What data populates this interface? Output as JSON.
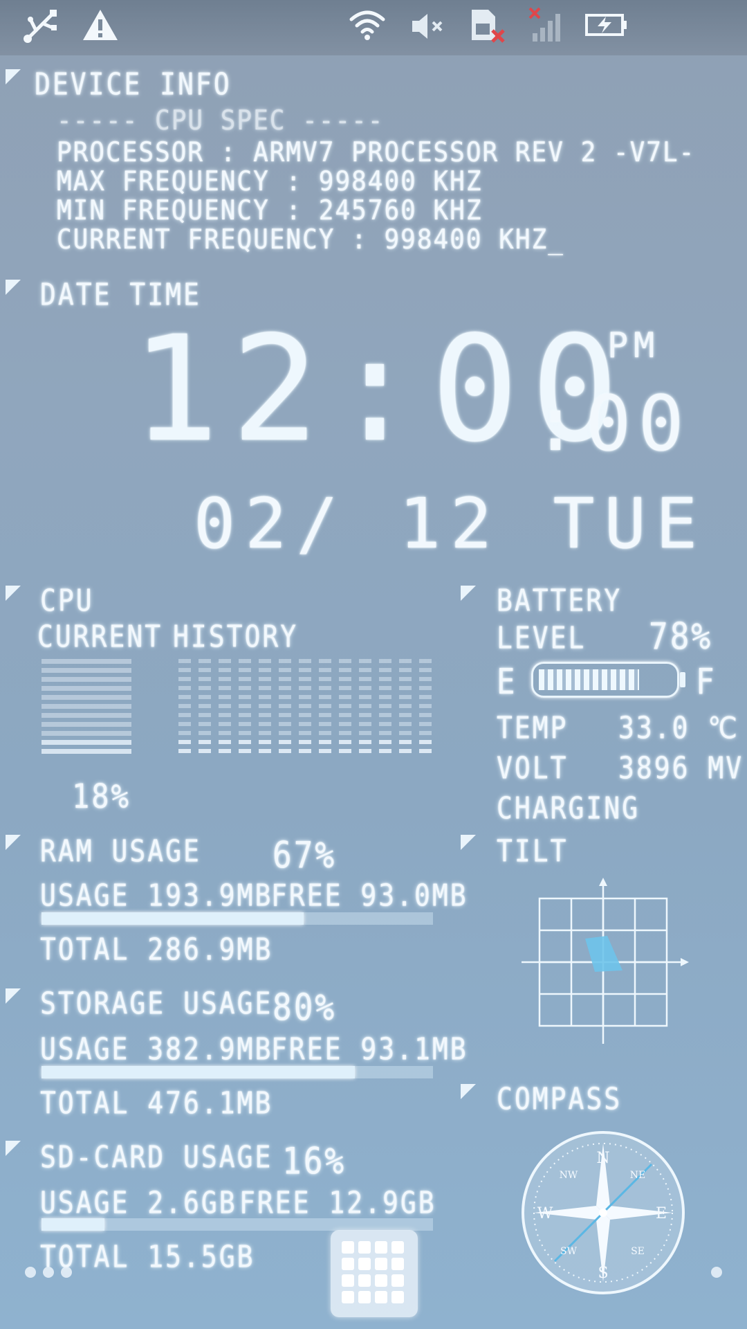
{
  "status_bar": {
    "icons": [
      "usb-icon",
      "warning-icon",
      "wifi-icon",
      "mute-icon",
      "no-sim-icon",
      "no-signal-icon",
      "battery-charging-icon"
    ]
  },
  "device_info": {
    "title": "DEVICE INFO",
    "cpu_spec_header": "-----  CPU SPEC  -----",
    "processor": "PROCESSOR : ARMV7 PROCESSOR REV 2 -V7L-",
    "max_freq": "MAX FREQUENCY : 998400 KHZ",
    "min_freq": "MIN FREQUENCY : 245760 KHZ",
    "cur_freq": "CURRENT FREQUENCY : 998400 KHZ_"
  },
  "date_time": {
    "title": "DATE TIME",
    "time": "12:00",
    "seconds": ":00",
    "ampm": "PM",
    "date": "02/ 12  TUE"
  },
  "cpu": {
    "title": "CPU",
    "current_label": "CURRENT",
    "history_label": "HISTORY",
    "percent": "18%"
  },
  "battery": {
    "title": "BATTERY",
    "level_label": "LEVEL",
    "level": "78%",
    "level_fraction": 0.78,
    "empty": "E",
    "full": "F",
    "temp_label": "TEMP",
    "temp": "33.0 ℃",
    "volt_label": "VOLT",
    "volt": "3896 MV",
    "status": "CHARGING"
  },
  "ram": {
    "title": "RAM USAGE",
    "percent": "67%",
    "usage": "USAGE 193.9MB",
    "free": "FREE 93.0MB",
    "total": "TOTAL 286.9MB",
    "fraction": 0.67
  },
  "storage": {
    "title": "STORAGE USAGE",
    "percent": "80%",
    "usage": "USAGE 382.9MB",
    "free": "FREE 93.1MB",
    "total": "TOTAL 476.1MB",
    "fraction": 0.8
  },
  "sdcard": {
    "title": "SD-CARD USAGE",
    "percent": "16%",
    "usage": "USAGE 2.6GB",
    "free": "FREE 12.9GB",
    "total": "TOTAL 15.5GB",
    "fraction": 0.16
  },
  "tilt": {
    "title": "TILT"
  },
  "compass": {
    "title": "COMPASS",
    "n": "N",
    "s": "S",
    "e": "E",
    "w": "W",
    "ne": "NE",
    "nw": "NW",
    "se": "SE",
    "sw": "SW"
  },
  "colors": {
    "accent": "#eaf6fd",
    "bar_fill": "#dff0fb",
    "tilt_fill": "#6ec3ea"
  }
}
